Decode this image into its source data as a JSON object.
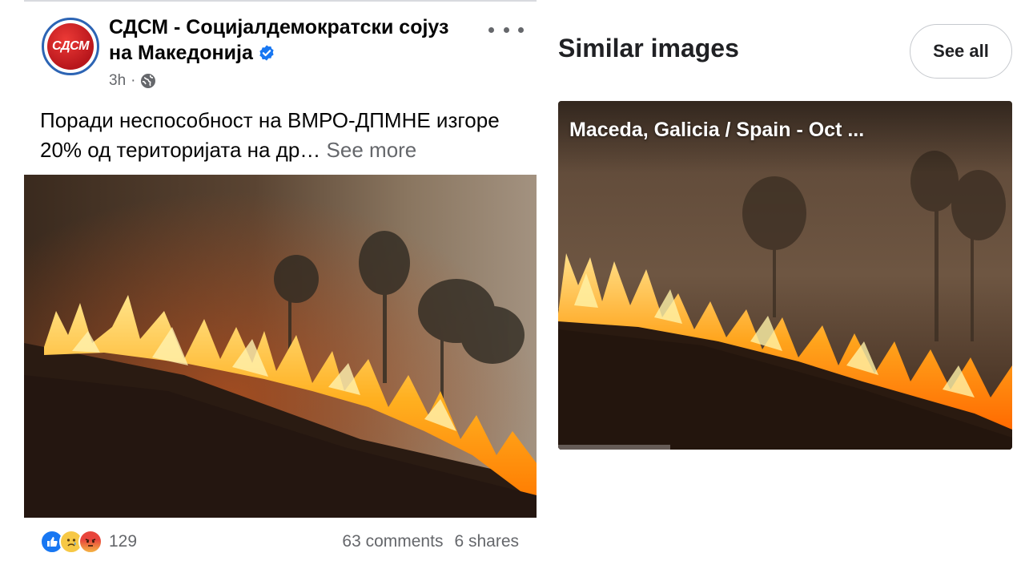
{
  "post": {
    "avatar_text": "СДСМ",
    "page_name": "СДСМ - Социјалдемократски сојуз на Македонија",
    "time": "3h",
    "separator": "·",
    "text": "Поради неспособност на ВМРО-ДПМНЕ изгоре 20% од територијата на др…",
    "see_more": "See more",
    "reaction_count": "129",
    "comments": "63 comments",
    "shares": "6 shares",
    "photo_subject": "wildfire-on-hillside"
  },
  "similar": {
    "title": "Similar images",
    "see_all": "See all",
    "result_caption": "Maceda, Galicia / Spain - Oct ...",
    "photo_subject": "wildfire-on-hillside"
  },
  "colors": {
    "brand_red": "#d7262b",
    "facebook_blue": "#1877f2",
    "meta_gray": "#65676b"
  },
  "icons": [
    "verified-badge-icon",
    "globe-icon",
    "more-options-icon",
    "like-reaction-icon",
    "sad-reaction-icon",
    "angry-reaction-icon"
  ]
}
